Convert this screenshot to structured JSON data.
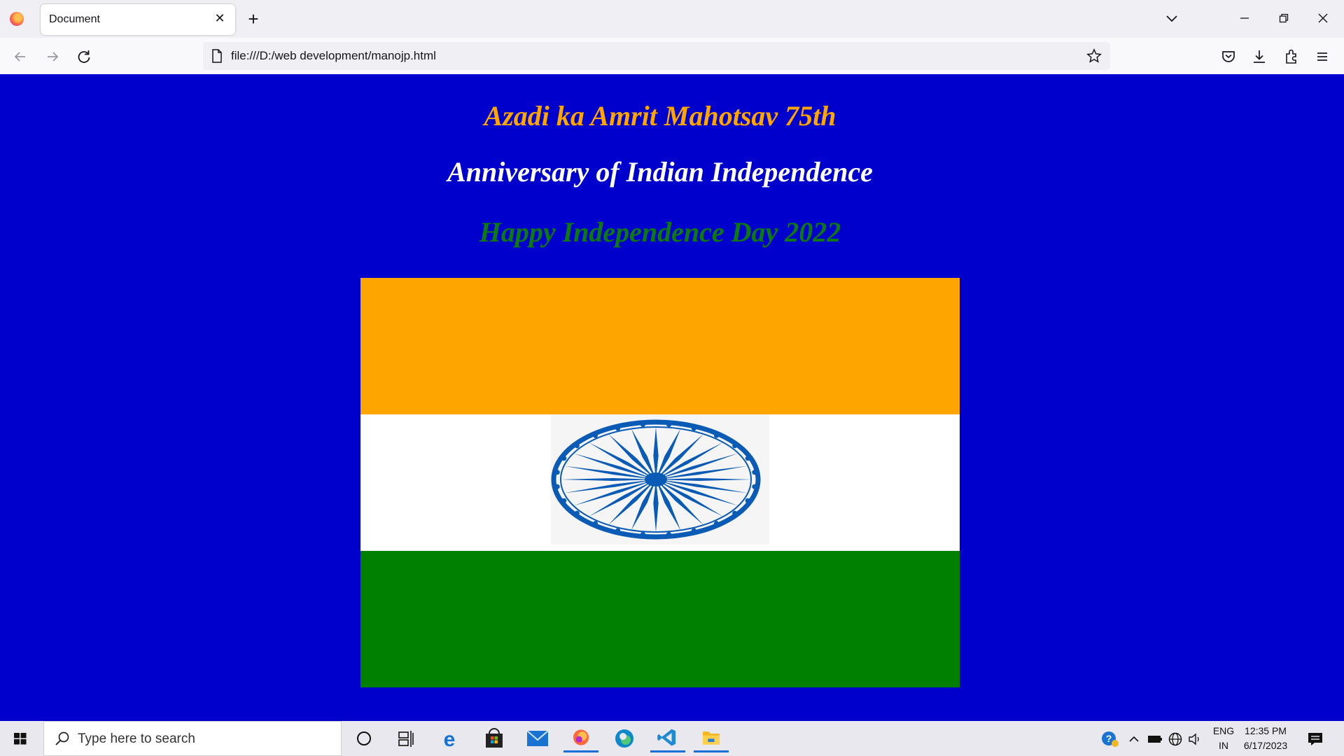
{
  "browser": {
    "tab_title": "Document",
    "url": "file:///D:/web development/manojp.html"
  },
  "page": {
    "heading1": "Azadi ka Amrit Mahotsav 75th",
    "heading2": "Anniversary of Indian Independence",
    "heading3": "Happy Independence Day 2022",
    "flag_colors": {
      "saffron": "#ffa500",
      "white": "#ffffff",
      "green": "#008000",
      "chakra": "#0a5bb5"
    },
    "background_color": "#0000cc"
  },
  "taskbar": {
    "search_placeholder": "Type here to search",
    "language_line1": "ENG",
    "language_line2": "IN",
    "time": "12:35 PM",
    "date": "6/17/2023"
  }
}
